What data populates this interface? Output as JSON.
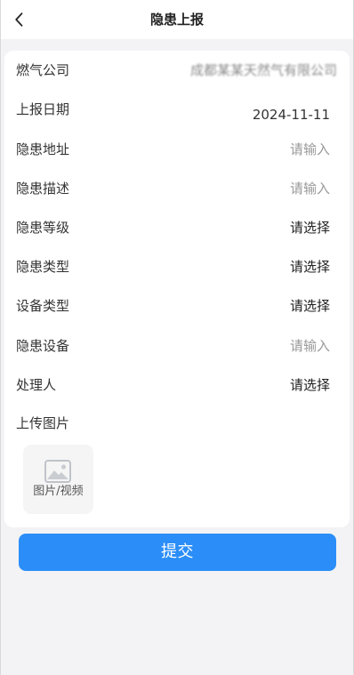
{
  "header": {
    "title": "隐患上报"
  },
  "form": {
    "rows": [
      {
        "label": "燃气公司",
        "value": "成都某某天然气有限公司"
      },
      {
        "label": "上报日期",
        "value": "2024-11-11"
      },
      {
        "label": "隐患地址",
        "value": "请输入"
      },
      {
        "label": "隐患描述",
        "value": "请输入"
      },
      {
        "label": "隐患等级",
        "value": "请选择"
      },
      {
        "label": "隐患类型",
        "value": "请选择"
      },
      {
        "label": "设备类型",
        "value": "请选择"
      },
      {
        "label": "隐患设备",
        "value": "请输入"
      },
      {
        "label": "处理人",
        "value": "请选择"
      }
    ],
    "upload": {
      "label": "上传图片",
      "button_label": "图片/视频",
      "icon": "image-icon"
    }
  },
  "actions": {
    "submit_label": "提交"
  },
  "colors": {
    "primary": "#2b8ef8",
    "background": "#f3f3f5",
    "card": "#ffffff",
    "placeholder": "#999999"
  }
}
